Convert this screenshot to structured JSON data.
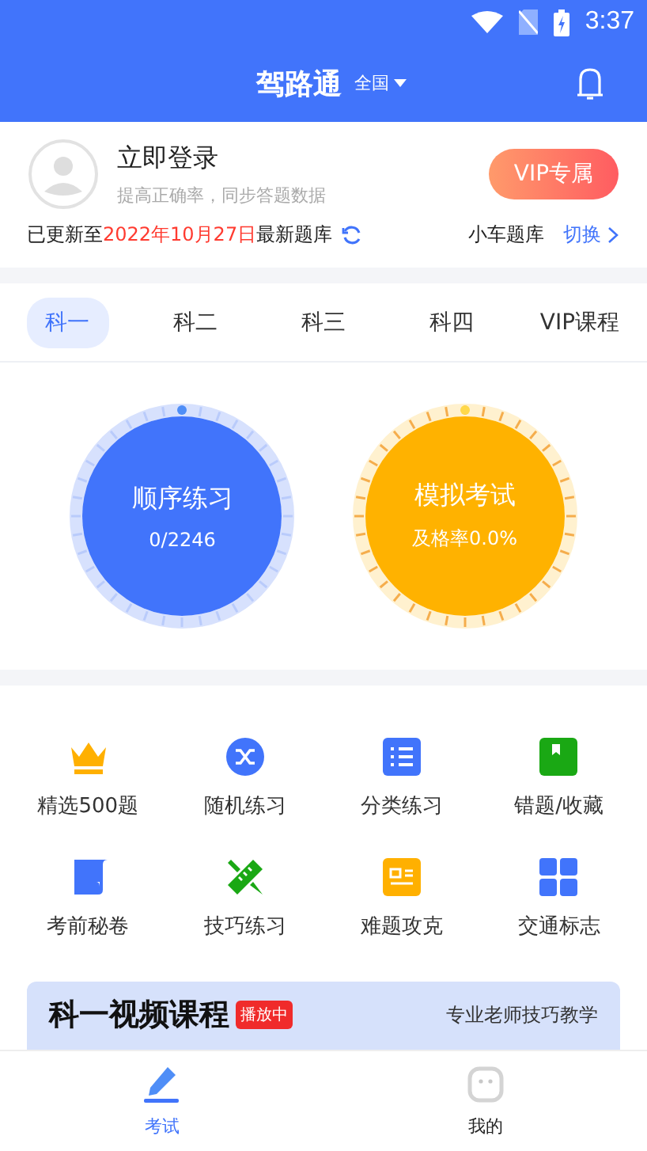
{
  "status_bar": {
    "time": "3:37"
  },
  "header": {
    "title": "驾路通",
    "region": "全国"
  },
  "login": {
    "title": "立即登录",
    "subtitle": "提高正确率，同步答题数据",
    "vip_button": "VIP专属"
  },
  "update": {
    "prefix": "已更新至",
    "date": "2022年10月27日",
    "suffix": "最新题库",
    "bank": "小车题库",
    "switch": "切换"
  },
  "tabs": [
    {
      "label": "科一",
      "selected": true
    },
    {
      "label": "科二",
      "selected": false
    },
    {
      "label": "科三",
      "selected": false
    },
    {
      "label": "科四",
      "selected": false
    },
    {
      "label": "VIP课程",
      "selected": false
    }
  ],
  "practice": [
    {
      "kind": "sequence",
      "title": "顺序练习",
      "detail": "0/2246"
    },
    {
      "kind": "exam",
      "title": "模拟考试",
      "detail": "及格率0.0%"
    }
  ],
  "grid": [
    {
      "label": "精选500题"
    },
    {
      "label": "随机练习"
    },
    {
      "label": "分类练习"
    },
    {
      "label": "错题/收藏"
    },
    {
      "label": "考前秘卷"
    },
    {
      "label": "技巧练习"
    },
    {
      "label": "难题攻克"
    },
    {
      "label": "交通标志"
    }
  ],
  "video_card": {
    "title": "科一视频课程",
    "badge": "播放中",
    "subtitle": "专业老师技巧教学"
  },
  "bottom_nav": [
    {
      "label": "考试",
      "selected": true
    },
    {
      "label": "我的",
      "selected": false
    }
  ]
}
